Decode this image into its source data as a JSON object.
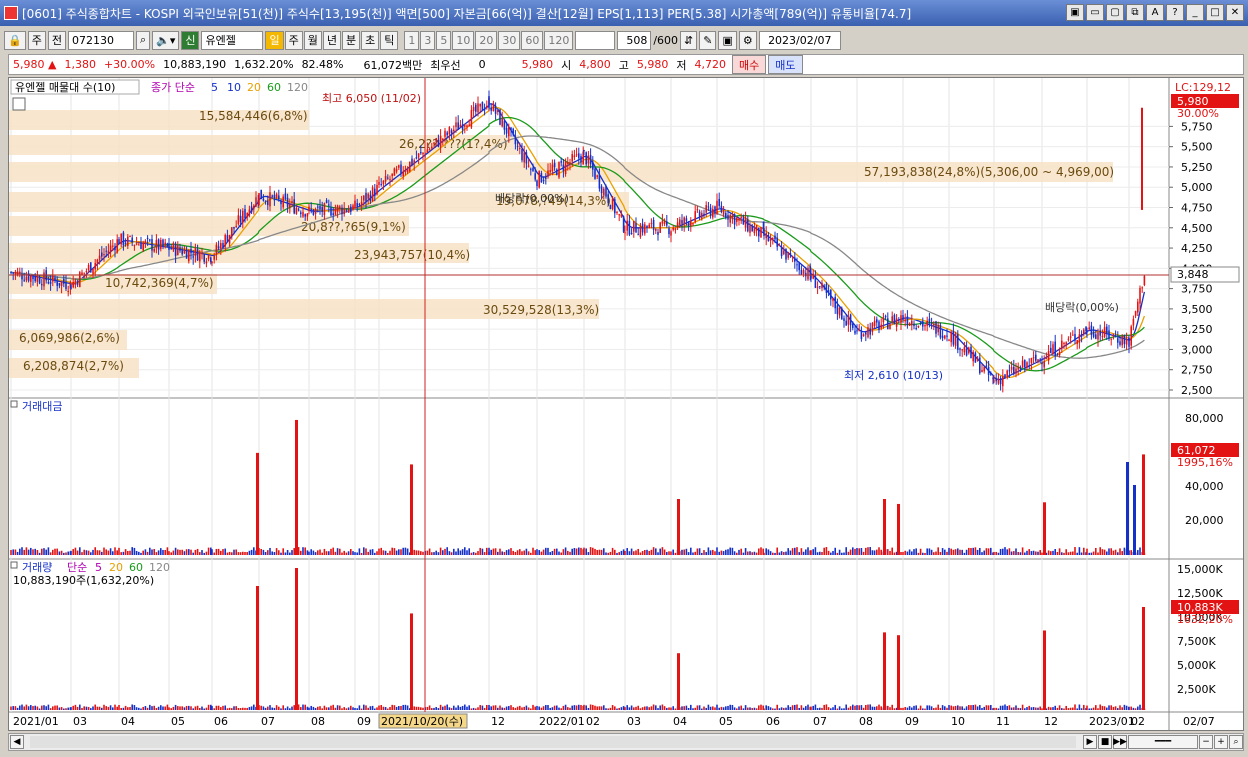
{
  "window": {
    "title": "[0601] 주식종합차트 - KOSPI 외국인보유[51(천)] 주식수[13,195(천)] 액면[500] 자본금[66(억)] 결산[12월] EPS[1,113] PER[5.38] 시가총액[789(억)] 유통비율[74.7]",
    "buttons": [
      "▣",
      "▭",
      "▢",
      "⧉",
      "A",
      "?",
      "_",
      "□",
      "✕"
    ]
  },
  "toolbar": {
    "period_unit": "주",
    "market_label": "전",
    "stock_code": "072130",
    "stock_badge": "신",
    "stock_name": "유엔젤",
    "periods": [
      "일",
      "주",
      "월",
      "년",
      "분",
      "초",
      "틱"
    ],
    "selected_period": "일",
    "minute_values": [
      "1",
      "3",
      "5",
      "10",
      "20",
      "30",
      "60",
      "120"
    ],
    "count": "508",
    "count_total": "/600",
    "date": "2023/02/07"
  },
  "quote": {
    "price": "5,980",
    "arrow": "▲",
    "change": "1,380",
    "change_pct": "+30.00%",
    "volume": "10,883,190",
    "volume_pct": "1,632.20%",
    "volume_rate": "82.48%",
    "amount": "61,072백만",
    "preferred_label": "최우선",
    "preferred_value": "0",
    "best_price": "5,980",
    "open_label": "시",
    "open": "4,800",
    "high_label": "고",
    "high": "5,980",
    "low_label": "저",
    "low": "4,720",
    "buy_label": "매수",
    "sell_label": "매도"
  },
  "price_panel": {
    "header_stock": "유엔젤 매물대 수(10)",
    "header_ma_label": "종가 단순",
    "ma_periods": [
      "5",
      "10",
      "20",
      "60",
      "120"
    ],
    "ma_colors": [
      "#1530c8",
      "#1530c8",
      "#e8a000",
      "#1a9a1a",
      "#888888"
    ],
    "lc_label": "LC:129,12",
    "current_price_tag": "5,980",
    "current_pct_tag": "30.00%",
    "line_price_tag": "3,848",
    "y_ticks": [
      "5,750",
      "5,500",
      "5,250",
      "5,000",
      "4,750",
      "4,500",
      "4,250",
      "4,000",
      "3,750",
      "3,500",
      "3,250",
      "3,000",
      "2,750",
      "2,500"
    ],
    "high_annotation": "최고 6,050 (11/02)",
    "low_annotation": "최저 2,610 (10/13)",
    "dividend_label": "배당락(0,00%)",
    "dividend_label2": "배당락(0,00%)",
    "volume_profile": [
      {
        "label": "57,193,838(24,8%)(5,306,00 ~ 4,969,00)",
        "share": 24.8
      },
      {
        "label": "30,529,528(13,3%)",
        "share": 13.3
      },
      {
        "label": "26,2??,???(1?,4%)",
        "share": 11.4
      },
      {
        "label": "23,943,757(10,4%)",
        "share": 10.4
      },
      {
        "label": "20,8??,?65(9,1%)",
        "share": 9.1
      },
      {
        "label": "19,078,?49(14,3%)",
        "share": 8.3
      },
      {
        "label": "15,584,446(6,8%)",
        "share": 6.8
      },
      {
        "label": "10,742,369(4,7%)",
        "share": 4.7
      },
      {
        "label": "6,208,874(2,7%)",
        "share": 2.7
      },
      {
        "label": "6,069,986(2,6%)",
        "share": 2.6
      }
    ]
  },
  "amount_panel": {
    "title": "거래대금",
    "y_ticks": [
      "80,000",
      "60,000",
      "40,000",
      "20,000"
    ],
    "value_tag": "61,072",
    "pct_tag": "1995,16%"
  },
  "volume_panel": {
    "title": "거래량",
    "ma_label": "단순",
    "ma_periods": [
      "5",
      "20",
      "60",
      "120"
    ],
    "info": "10,883,190주(1,632,20%)",
    "y_ticks": [
      "15,000K",
      "12,500K",
      "10,000K",
      "7,500K",
      "5,000K",
      "2,500K"
    ],
    "value_tag": "10,883K",
    "pct_tag": "1632,20%"
  },
  "x_axis": {
    "labels": [
      "2021/01",
      "03",
      "04",
      "05",
      "06",
      "07",
      "08",
      "09",
      "2021/10/20(수)",
      "12",
      "2022/01",
      "02",
      "03",
      "04",
      "05",
      "06",
      "07",
      "08",
      "09",
      "10",
      "11",
      "12",
      "2023/01",
      "02",
      "02/07"
    ]
  },
  "chart_data": {
    "type": "candlestick",
    "title": "",
    "ylim": [
      2500,
      6100
    ],
    "price_path": [
      [
        "2021/01",
        3950
      ],
      [
        "2021/03",
        3800
      ],
      [
        "2021/04",
        4350
      ],
      [
        "2021/05",
        4250
      ],
      [
        "2021/06",
        4150
      ],
      [
        "2021/07",
        4900
      ],
      [
        "2021/08",
        4700
      ],
      [
        "2021/09",
        4750
      ],
      [
        "2021/10",
        5000
      ],
      [
        "2021/11",
        6050
      ],
      [
        "2021/12",
        5100
      ],
      [
        "2022/01",
        5400
      ],
      [
        "2022/02",
        4500
      ],
      [
        "2022/03",
        4500
      ],
      [
        "2022/04",
        4750
      ],
      [
        "2022/05",
        4400
      ],
      [
        "2022/06",
        3900
      ],
      [
        "2022/07",
        3200
      ],
      [
        "2022/08",
        3400
      ],
      [
        "2022/09",
        3200
      ],
      [
        "2022/10",
        2610
      ],
      [
        "2022/11",
        2900
      ],
      [
        "2022/12",
        3250
      ],
      [
        "2023/01",
        3100
      ],
      [
        "2023/02",
        5980
      ]
    ],
    "high": {
      "value": 6050,
      "date": "11/02"
    },
    "low": {
      "value": 2610,
      "date": "10/13"
    },
    "last_close": 5980,
    "amount_spikes": [
      [
        "2021/07",
        62000
      ],
      [
        "2021/07",
        82000
      ],
      [
        "2021/10",
        55000
      ],
      [
        "2022/04",
        34000
      ],
      [
        "2022/08",
        34000
      ],
      [
        "2022/09",
        31000
      ],
      [
        "2022/12",
        32000
      ],
      [
        "2023/02",
        61072
      ]
    ],
    "volume_spikes": [
      [
        "2021/07",
        13100
      ],
      [
        "2021/07",
        15000
      ],
      [
        "2021/10",
        10200
      ],
      [
        "2022/04",
        6000
      ],
      [
        "2022/08",
        8200
      ],
      [
        "2022/09",
        7900
      ],
      [
        "2022/12",
        8400
      ],
      [
        "2023/02",
        10883
      ]
    ]
  }
}
